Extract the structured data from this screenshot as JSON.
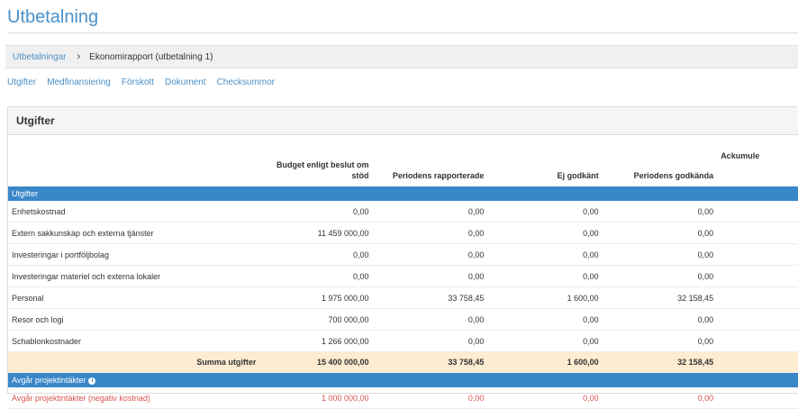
{
  "page": {
    "title": "Utbetalning"
  },
  "breadcrumb": {
    "link": "Utbetalningar",
    "separator": "›",
    "current": "Ekonomirapport (utbetalning 1)"
  },
  "tabs": [
    "Utgifter",
    "Medfinansiering",
    "Förskott",
    "Dokument",
    "Checksummor"
  ],
  "panel": {
    "title": "Utgifter"
  },
  "table": {
    "columns": {
      "budget_line1": "Budget enligt beslut om",
      "budget_line2": "stöd",
      "reported": "Periodens rapporterade",
      "rejected": "Ej godkänt",
      "approved": "Periodens godkända",
      "accumulated": "Ackumule"
    },
    "section_expenses": "Utgifter",
    "rows": [
      {
        "label": "Enhetskostnad",
        "budget": "0,00",
        "reported": "0,00",
        "rejected": "0,00",
        "approved": "0,00"
      },
      {
        "label": "Extern sakkunskap och externa tjänster",
        "budget": "11 459 000,00",
        "reported": "0,00",
        "rejected": "0,00",
        "approved": "0,00"
      },
      {
        "label": "Investeringar i portföljbolag",
        "budget": "0,00",
        "reported": "0,00",
        "rejected": "0,00",
        "approved": "0,00"
      },
      {
        "label": "Investeringar materiel och externa lokaler",
        "budget": "0,00",
        "reported": "0,00",
        "rejected": "0,00",
        "approved": "0,00"
      },
      {
        "label": "Personal",
        "budget": "1 975 000,00",
        "reported": "33 758,45",
        "rejected": "1 600,00",
        "approved": "32 158,45"
      },
      {
        "label": "Resor och logi",
        "budget": "700 000,00",
        "reported": "0,00",
        "rejected": "0,00",
        "approved": "0,00"
      },
      {
        "label": "Schablonkostnader",
        "budget": "1 266 000,00",
        "reported": "0,00",
        "rejected": "0,00",
        "approved": "0,00"
      }
    ],
    "sum": {
      "label": "Summa utgifter",
      "budget": "15 400 000,00",
      "reported": "33 758,45",
      "rejected": "1 600,00",
      "approved": "32 158,45"
    },
    "section_income": "Avgår projektintäkter",
    "income_info_icon": "info-icon",
    "income_row": {
      "label": "Avgår projektintäkter (negativ kostnad)",
      "budget": "1 000 000,00",
      "reported": "0,00",
      "rejected": "0,00",
      "approved": "0,00"
    }
  },
  "colors": {
    "link": "#4a90c8",
    "section_bg": "#3a87c8",
    "sum_bg": "#fdecd1",
    "negative": "#d9534f"
  }
}
